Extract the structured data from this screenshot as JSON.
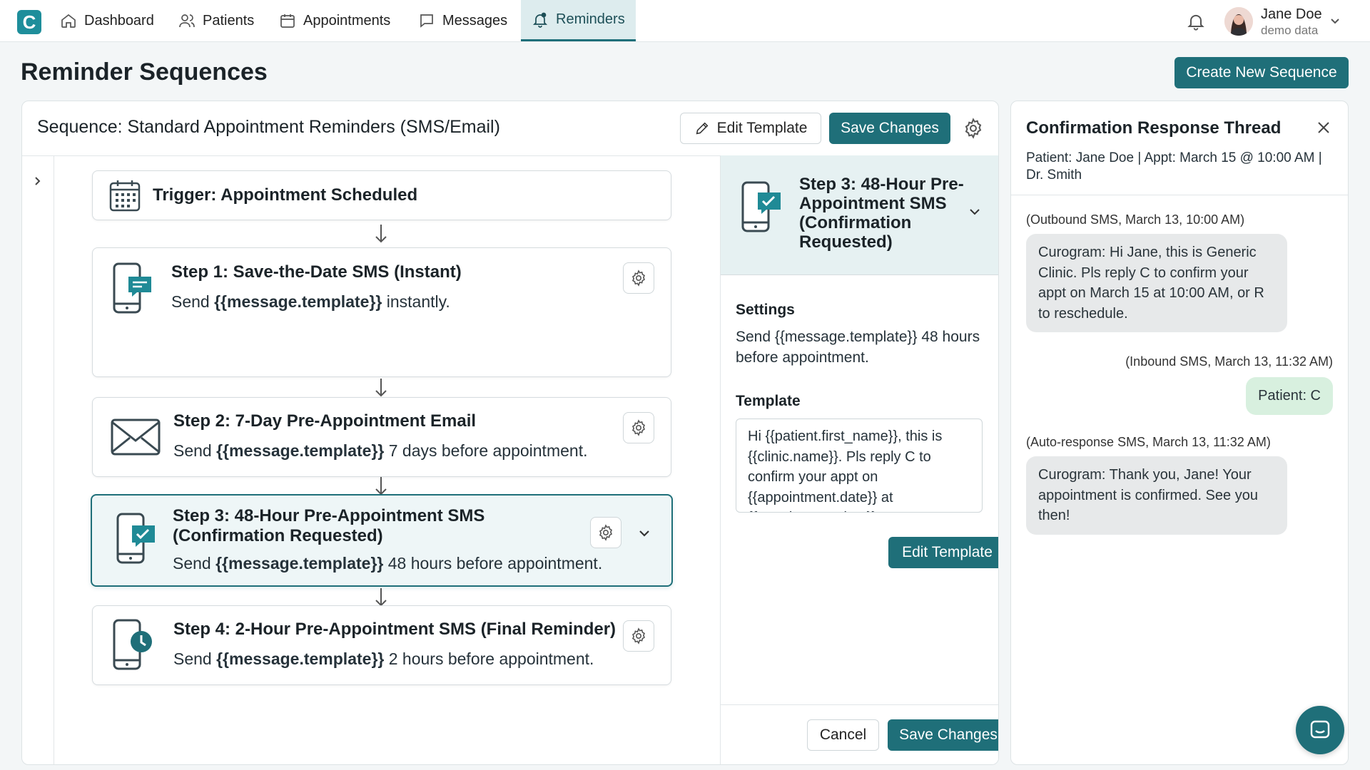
{
  "nav": {
    "logo_letter": "C",
    "items": [
      {
        "label": "Dashboard",
        "icon": "home-icon"
      },
      {
        "label": "Patients",
        "icon": "users-icon"
      },
      {
        "label": "Appointments",
        "icon": "calendar-icon"
      },
      {
        "label": "Messages",
        "icon": "message-icon"
      },
      {
        "label": "Reminders",
        "icon": "bell-icon",
        "active": true
      }
    ],
    "user": {
      "name": "Jane Doe",
      "subtitle": "demo data"
    }
  },
  "page": {
    "title": "Reminder Sequences",
    "create_button": "Create New Sequence"
  },
  "sequence": {
    "title": "Sequence: Standard Appointment Reminders (SMS/Email)",
    "edit_template_button": "Edit Template",
    "save_button": "Save Changes",
    "trigger": "Trigger: Appointment Scheduled",
    "steps": [
      {
        "title": "Step 1: Save-the-Date SMS (Instant)",
        "desc_prefix": "Send ",
        "desc_var": "{{message.template}}",
        "desc_suffix": " instantly.",
        "icon": "phone-message-icon"
      },
      {
        "title": "Step 2: 7-Day Pre-Appointment Email",
        "desc_prefix": "Send ",
        "desc_var": "{{message.template}}",
        "desc_suffix": " 7 days before appointment.",
        "icon": "envelope-icon"
      },
      {
        "title_line1": "Step 3: 48-Hour Pre-Appointment SMS",
        "title_line2": "(Confirmation Requested)",
        "desc_prefix": "Send ",
        "desc_var": "{{message.template}}",
        "desc_suffix": " 48 hours before appointment.",
        "icon": "phone-check-icon",
        "active": true
      },
      {
        "title": "Step 4: 2-Hour Pre-Appointment SMS (Final Reminder)",
        "desc_prefix": "Send ",
        "desc_var": "{{message.template}}",
        "desc_suffix": " 2 hours before appointment.",
        "icon": "phone-clock-icon"
      }
    ]
  },
  "detail": {
    "title": "Step 3: 48-Hour Pre-Appointment SMS (Confirmation Requested)",
    "settings_label": "Settings",
    "settings_text": "Send {{message.template}} 48 hours before appointment.",
    "template_label": "Template",
    "template_text": "Hi {{patient.first_name}}, this is {{clinic.name}}. Pls reply C to confirm your appt on {{appointment.date}} at {{appointment.time}}, or R to resched",
    "edit_template_button": "Edit Template",
    "cancel_button": "Cancel",
    "save_button": "Save Changes"
  },
  "thread": {
    "title": "Confirmation Response Thread",
    "meta": "Patient: Jane Doe | Appt: March 15 @ 10:00 AM | Dr. Smith",
    "messages": [
      {
        "caption": "(Outbound SMS, March 13, 10:00 AM)",
        "text": "Curogram: Hi Jane, this is Generic Clinic. Pls reply C to confirm your appt on March 15 at 10:00 AM, or R to reschedule.",
        "direction": "outbound"
      },
      {
        "caption": "(Inbound SMS, March 13, 11:32 AM)",
        "text": "Patient: C",
        "direction": "inbound"
      },
      {
        "caption": "(Auto-response SMS, March 13, 11:32 AM)",
        "text": "Curogram: Thank you, Jane! Your appointment is confirmed. See you then!",
        "direction": "outbound"
      }
    ]
  },
  "colors": {
    "primary": "#1f6f79",
    "logo": "#1e8e9b",
    "active_bg": "#ddecee",
    "inbound_bubble": "#d8f0df",
    "outbound_bubble": "#e7e9ea"
  }
}
